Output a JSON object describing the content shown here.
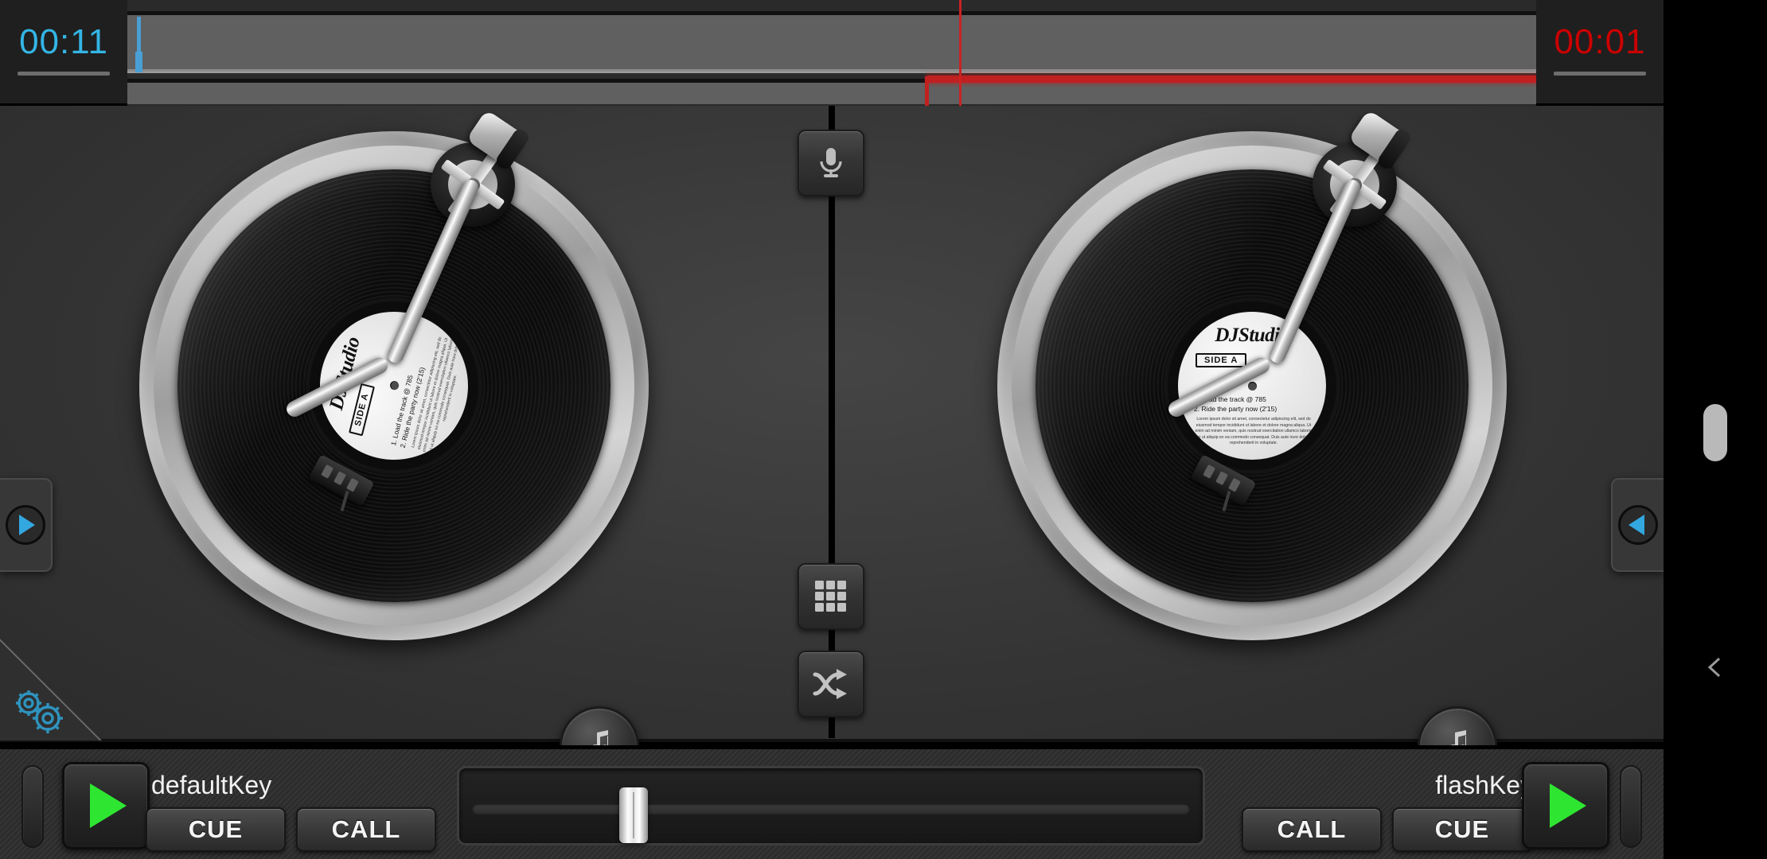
{
  "app": {
    "name": "DJ Studio",
    "accent_blue": "#33b5e5",
    "accent_red": "#cc0000",
    "play_green": "#2ee632"
  },
  "timeline": {
    "left_timer": "00:11",
    "right_timer": "00:01",
    "lane_a_name": "deck-a-waveform",
    "lane_b_name": "deck-b-waveform",
    "playhead_label": "playhead"
  },
  "deck_a": {
    "id": "A",
    "vinyl": {
      "brand": "DJStudio",
      "side": "SIDE A",
      "track1": "1.  Load the track @ 785",
      "track2": "2.  Ride the party now (2'15)",
      "legal": "Lorem ipsum dolor sit amet, consectetur adipiscing elit, sed do eiusmod tempor incididunt ut labore et dolore magna aliqua. Ut enim ad minim veniam, quis nostrud exercitation ullamco laboris nisi ut aliquip ex ea commodo consequat. Duis aute irure dolor in reprehenderit in voluptate."
    },
    "add_music_icon": "music-note-plus-icon",
    "drawer_icon": "triangle-right-icon"
  },
  "deck_b": {
    "id": "B",
    "vinyl": {
      "brand": "DJStudio",
      "side": "SIDE A",
      "track1": "1.  Load the track @ 785",
      "track2": "2.  Ride the party now (2'15)",
      "legal": "Lorem ipsum dolor sit amet, consectetur adipiscing elit, sed do eiusmod tempor incididunt ut labore et dolore magna aliqua. Ut enim ad minim veniam, quis nostrud exercitation ullamco laboris nisi ut aliquip ex ea commodo consequat. Duis aute irure dolor in reprehenderit in voluptate."
    },
    "add_music_icon": "music-note-plus-icon",
    "drawer_icon": "triangle-left-icon"
  },
  "center_column": {
    "mic_icon": "microphone-icon",
    "grid_icon": "grid-3x3-icon",
    "shuffle_icon": "shuffle-icon"
  },
  "settings": {
    "icon": "gears-icon",
    "color": "#2e93bd"
  },
  "transport": {
    "left": {
      "play_icon": "play-icon",
      "key_label": "defaultKey",
      "cue_label": "CUE",
      "call_label": "CALL"
    },
    "right": {
      "play_icon": "play-icon",
      "key_label": "flashKey",
      "call_label": "CALL",
      "cue_label": "CUE"
    },
    "crossfader": {
      "name": "crossfader",
      "position_percent": 21
    }
  },
  "system_bar": {
    "scroll_handle": "scroll-handle",
    "back_icon": "chevron-left-icon"
  }
}
